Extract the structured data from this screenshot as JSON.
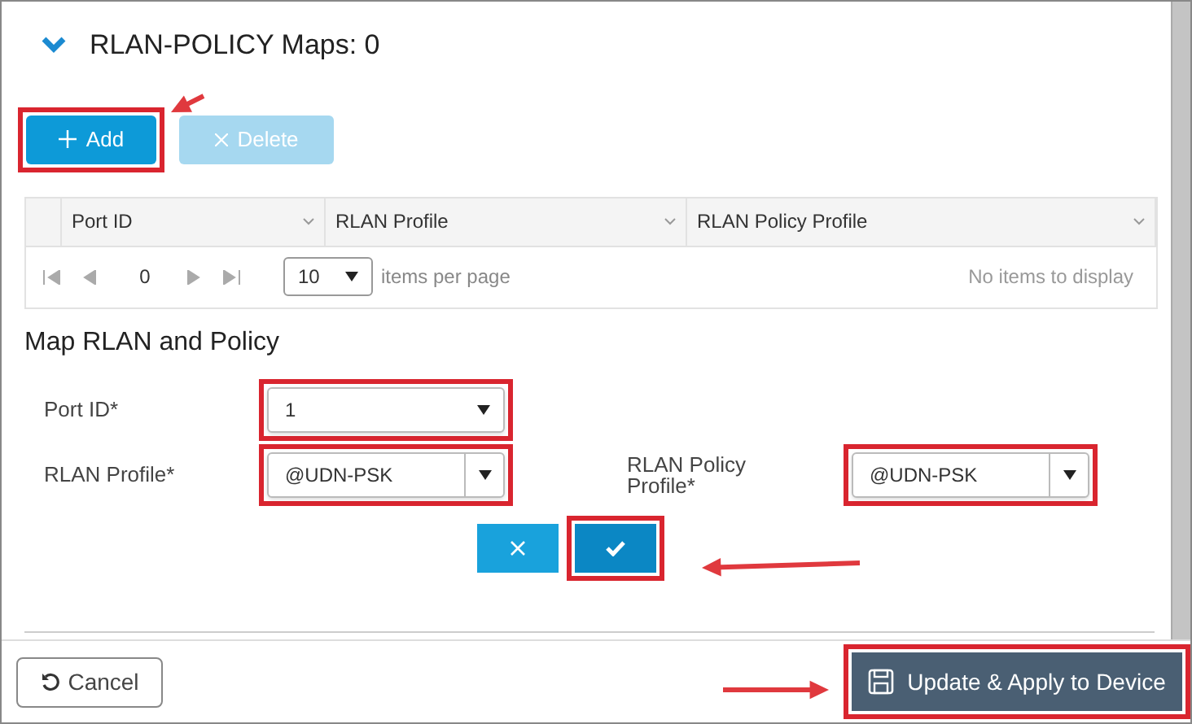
{
  "section": {
    "title": "RLAN-POLICY Maps: 0",
    "expanded": true
  },
  "toolbar": [
    {
      "label": "Add",
      "kind": "add",
      "disabled": false,
      "highlighted": true
    },
    {
      "label": "Delete",
      "kind": "delete",
      "disabled": true,
      "highlighted": false
    }
  ],
  "table": {
    "columns": [
      "Port ID",
      "RLAN Profile",
      "RLAN Policy Profile"
    ],
    "pager": {
      "page": "0",
      "page_size": "10",
      "page_size_label": "items per page",
      "empty_text": "No items to display"
    }
  },
  "form": {
    "title": "Map RLAN and Policy",
    "fields": [
      {
        "label": "Port ID*",
        "value": "1",
        "highlighted": true,
        "split": false
      },
      {
        "label": "RLAN Profile*",
        "value": "@UDN-PSK",
        "highlighted": true,
        "split": true
      },
      {
        "label": "RLAN Policy Profile*",
        "value": "@UDN-PSK",
        "highlighted": true,
        "split": true
      }
    ],
    "actions": [
      {
        "kind": "cancel",
        "highlighted": false
      },
      {
        "kind": "confirm",
        "highlighted": true
      }
    ]
  },
  "footer": {
    "cancel": {
      "label": "Cancel",
      "highlighted": false
    },
    "apply": {
      "label": "Update & Apply to Device",
      "highlighted": true
    }
  }
}
